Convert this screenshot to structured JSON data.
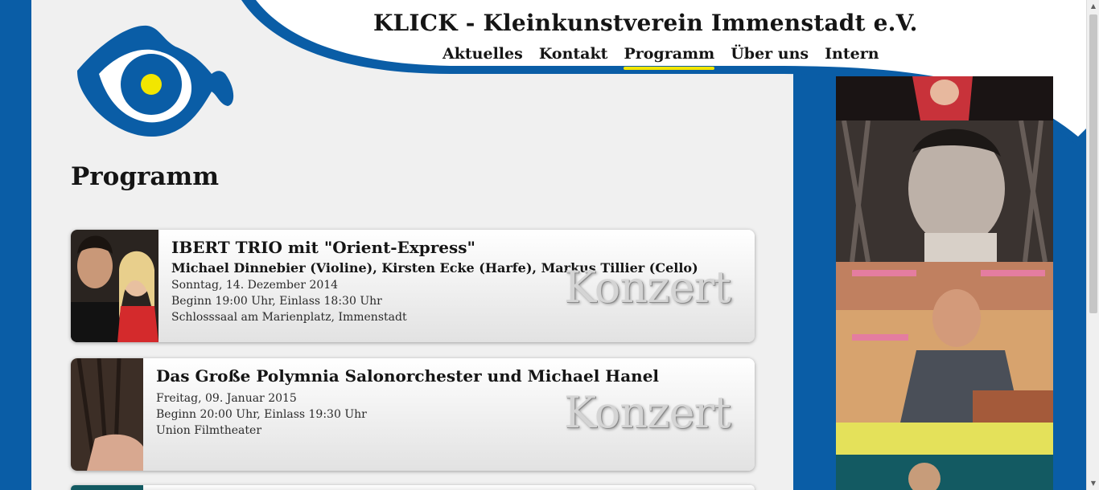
{
  "site": {
    "title": "KLICK - Kleinkunstverein Immenstadt e.V."
  },
  "nav": {
    "items": [
      {
        "label": "Aktuelles"
      },
      {
        "label": "Kontakt"
      },
      {
        "label": "Programm",
        "active": true
      },
      {
        "label": "Über uns"
      },
      {
        "label": "Intern"
      }
    ]
  },
  "page": {
    "title": "Programm"
  },
  "events": [
    {
      "title": "IBERT TRIO mit \"Orient-Express\"",
      "artists": "Michael Dinnebier (Violine), Kirsten Ecke (Harfe), Markus Tillier (Cello)",
      "date": "Sonntag, 14. Dezember 2014",
      "time": "Beginn 19:00 Uhr, Einlass 18:30 Uhr",
      "venue": "Schlosssaal am Marienplatz, Immenstadt",
      "category": "Konzert"
    },
    {
      "title": "Das Große Polymnia Salonorchester und Michael Hanel",
      "date": "Freitag, 09. Januar 2015",
      "time": "Beginn 20:00 Uhr, Einlass 19:30 Uhr",
      "venue": "Union Filmtheater",
      "category": "Konzert"
    }
  ],
  "colors": {
    "brand_blue": "#0a5da6",
    "accent_yellow": "#f2e600",
    "page_bg": "#f0f0f0"
  }
}
